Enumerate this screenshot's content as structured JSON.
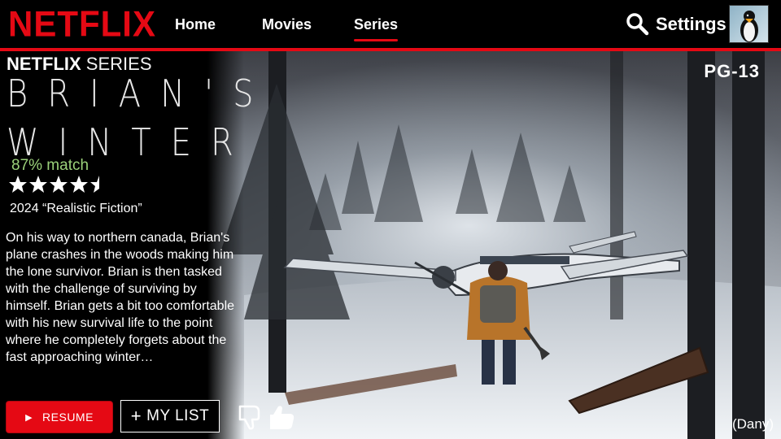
{
  "brand": {
    "logo_text": "NETFLIX",
    "color": "#e50914"
  },
  "nav": {
    "home": "Home",
    "movies": "Movies",
    "series": "Series",
    "active": "Series"
  },
  "header": {
    "settings_label": "Settings",
    "search_icon": "search-icon",
    "avatar_alt": "penguin avatar"
  },
  "hero": {
    "rating": "PG-13",
    "credit": "(Dany)",
    "label_bold": "NETFLIX",
    "label_light": "SERIES",
    "title_line1": "BRIAN'S",
    "title_line2": "WINTER",
    "match": "87% match",
    "stars": 4.5,
    "year_genre": "2024 “Realistic Fiction”",
    "description": "On his way to northern canada, Brian's plane crashes in the woods making him the lone survivor. Brian is then tasked with the challenge of surviving by himself. Brian gets a bit too comfortable with his new survival life to the point where he completely forgets about the fast approaching winter…",
    "colors": {
      "match": "#9bd17a",
      "accent": "#e50914"
    }
  },
  "actions": {
    "resume_label": "RESUME",
    "mylist_label": "MY LIST",
    "mylist_prefix": "+",
    "play_icon": "▶"
  }
}
